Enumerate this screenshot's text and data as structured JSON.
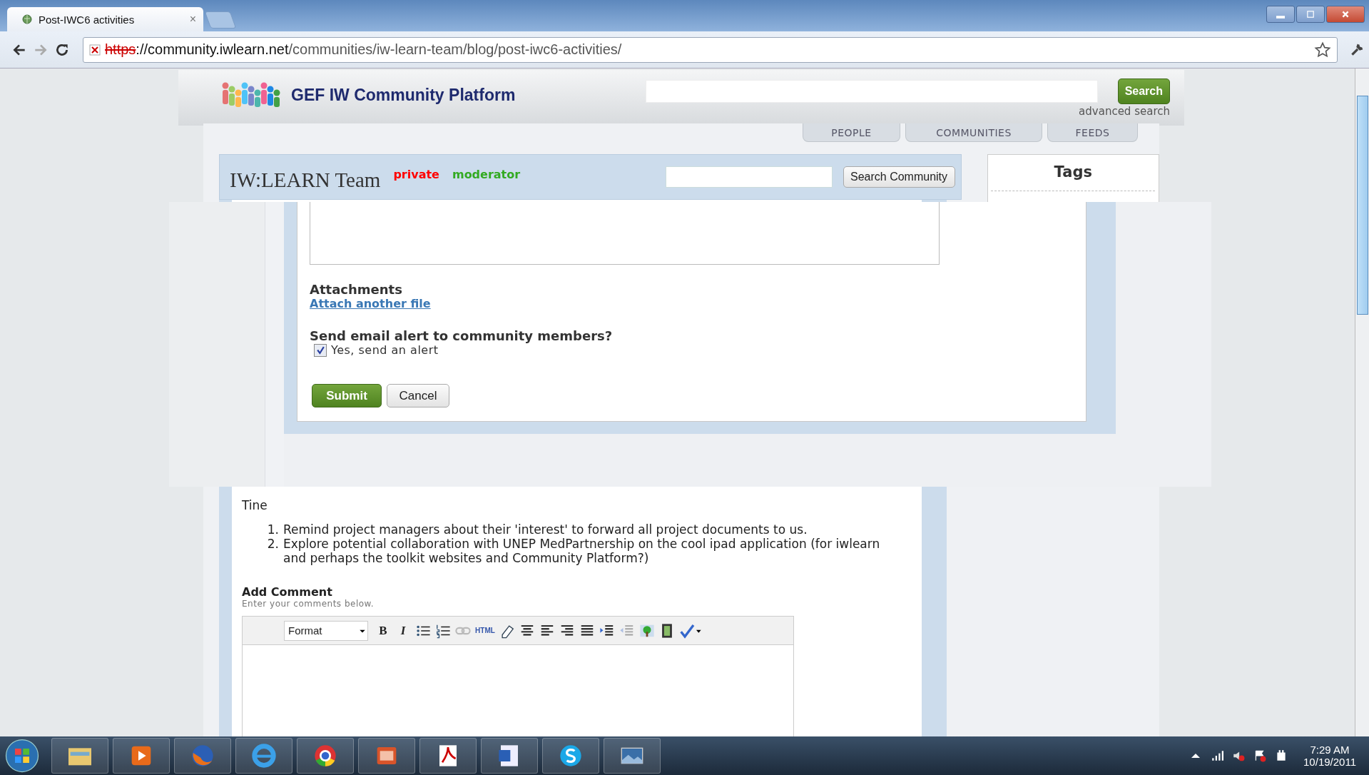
{
  "browser": {
    "tab": {
      "title": "Post-IWC6 activities",
      "close": "×"
    },
    "address": {
      "scheme": "https",
      "host": "://community.iwlearn.net",
      "path": "/communities/iw-learn-team/blog/post-iwc6-activities/",
      "insecure": true
    }
  },
  "site": {
    "name": "GEF IW Community Platform",
    "search_button": "Search",
    "advanced_search": "advanced search",
    "nav": [
      "PEOPLE",
      "COMMUNITIES",
      "FEEDS"
    ]
  },
  "community": {
    "title": "IW:LEARN Team",
    "badges": [
      {
        "label": "private",
        "color": "#ff0000"
      },
      {
        "label": "moderator",
        "color": "#33aa22"
      }
    ],
    "search_button": "Search Community"
  },
  "tags": {
    "title": "Tags"
  },
  "form": {
    "attachments_label": "Attachments",
    "attach_link": "Attach another file",
    "alert_label": "Send email alert to community members?",
    "alert_option": "Yes, send an alert",
    "alert_checked": true,
    "submit": "Submit",
    "cancel": "Cancel"
  },
  "post": {
    "signature": "Tine",
    "items": [
      {
        "marker": "1.",
        "text": "Remind project managers about their 'interest' to forward all project documents to us."
      },
      {
        "marker": "2.",
        "text": "Explore potential collaboration with UNEP MedPartnership on the cool ipad application (for iwlearn and perhaps the toolkit websites and Community Platform?)"
      }
    ]
  },
  "comment": {
    "title": "Add Comment",
    "hint": "Enter your comments below.",
    "toolbar": {
      "format": "Format",
      "bold": "B",
      "italic": "I",
      "html": "HTML",
      "link_disabled": true,
      "outdent_disabled": true
    }
  },
  "taskbar": {
    "time": "7:29 AM",
    "date": "10/19/2011"
  }
}
